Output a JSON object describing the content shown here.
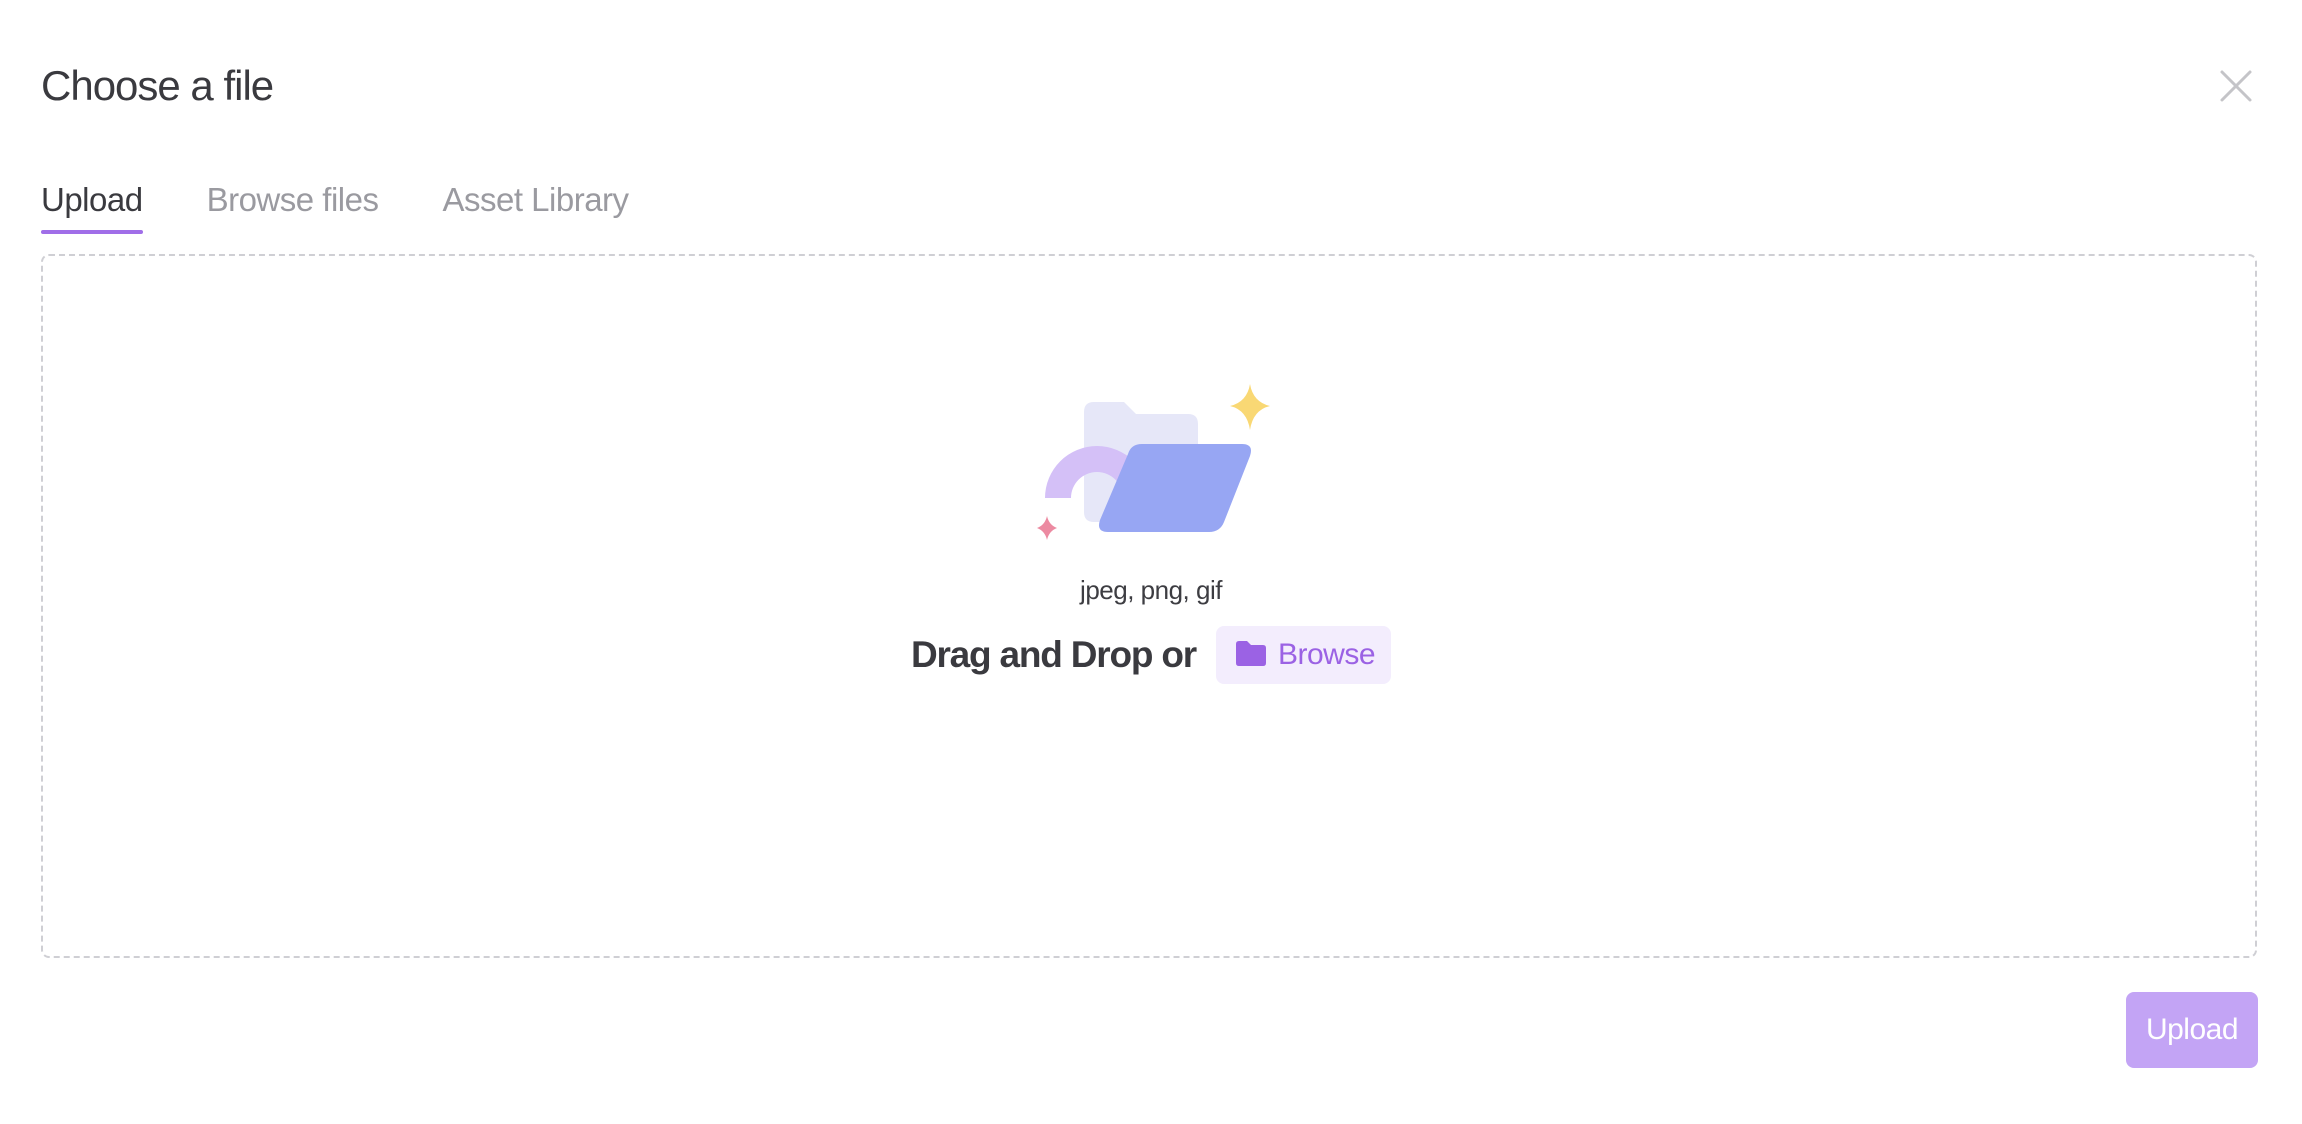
{
  "dialog": {
    "title": "Choose a file"
  },
  "tabs": [
    {
      "label": "Upload",
      "active": true
    },
    {
      "label": "Browse files",
      "active": false
    },
    {
      "label": "Asset Library",
      "active": false
    }
  ],
  "dropzone": {
    "formats": "jpeg, png, gif",
    "prompt": "Drag and Drop or",
    "browse_label": "Browse"
  },
  "footer": {
    "upload_label": "Upload"
  },
  "colors": {
    "accent": "#a06ee8",
    "upload_button": "#c3a4f5",
    "browse_bg": "#f3edfd",
    "browse_text": "#9b62e4",
    "folder_front": "#97a6f3",
    "folder_back": "#e6e7f8",
    "arc": "#d4c0f7",
    "sparkle_yellow": "#f9d874",
    "sparkle_pink": "#ec8aa1"
  },
  "icons": {
    "close": "close-icon",
    "browse": "folder-icon",
    "illustration": "folder-illustration-icon"
  }
}
